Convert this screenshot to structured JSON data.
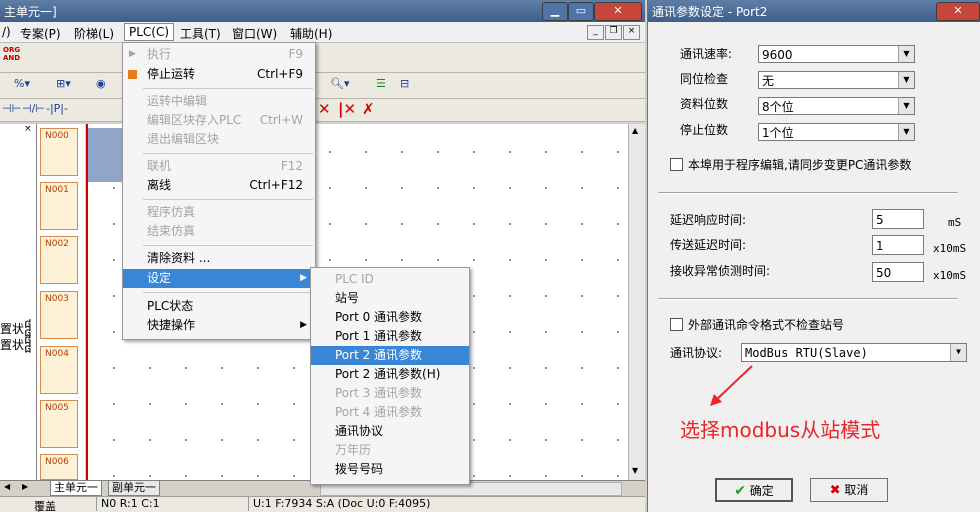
{
  "left_window": {
    "title": "主单元一]",
    "menubar": [
      "/) ",
      "专案(P)",
      "阶梯(L)",
      "PLC(C)",
      "工具(T)",
      "窗口(W)",
      "辅助(H)"
    ],
    "rungs": [
      "N000",
      "N001",
      "N002",
      "N003",
      "N004",
      "N005",
      "N006"
    ],
    "left_pane_text": [
      "置状᧰",
      "置状᧰"
    ],
    "tabs": [
      "主单元一",
      "副单元一"
    ],
    "status": {
      "left": "覆盖",
      "mid": "N0 R:1 C:1",
      "right": "U:1 F:7934 S:A (Doc U:0 F:4095)"
    },
    "toolbar_label": "ORG AND"
  },
  "plc_menu": {
    "items": [
      {
        "label": "执行",
        "shortcut": "F9",
        "disabled": true
      },
      {
        "label": "停止运转",
        "shortcut": "Ctrl+F9",
        "disabled": false
      },
      {
        "sep": true
      },
      {
        "label": "运转中编辑",
        "shortcut": "",
        "disabled": true
      },
      {
        "label": "编辑区块存入PLC",
        "shortcut": "Ctrl+W",
        "disabled": true
      },
      {
        "label": "退出编辑区块",
        "shortcut": "",
        "disabled": true
      },
      {
        "sep": true
      },
      {
        "label": "联机",
        "shortcut": "F12",
        "disabled": true
      },
      {
        "label": "离线",
        "shortcut": "Ctrl+F12",
        "disabled": false
      },
      {
        "sep": true
      },
      {
        "label": "程序仿真",
        "shortcut": "",
        "disabled": true
      },
      {
        "label": "结束仿真",
        "shortcut": "",
        "disabled": true
      },
      {
        "sep": true
      },
      {
        "label": "清除资料 ...",
        "shortcut": "",
        "disabled": false
      },
      {
        "label": "设定",
        "shortcut": "",
        "disabled": false,
        "highlight": true,
        "submenu": true
      },
      {
        "sep": true
      },
      {
        "label": "PLC状态",
        "shortcut": "",
        "disabled": false
      },
      {
        "label": "快捷操作",
        "shortcut": "",
        "disabled": false,
        "submenu": true
      }
    ]
  },
  "settings_submenu": {
    "items": [
      {
        "label": "PLC ID",
        "disabled": true
      },
      {
        "label": "站号",
        "disabled": false
      },
      {
        "label": "Port 0 通讯参数",
        "disabled": false
      },
      {
        "label": "Port 1 通讯参数",
        "disabled": false
      },
      {
        "label": "Port 2 通讯参数",
        "disabled": false,
        "highlight": true
      },
      {
        "label": "Port 2 通讯参数(H)",
        "disabled": false
      },
      {
        "label": "Port 3 通讯参数",
        "disabled": true
      },
      {
        "label": "Port 4 通讯参数",
        "disabled": true
      },
      {
        "label": "通讯协议",
        "disabled": false
      },
      {
        "label": "万年历",
        "disabled": true
      },
      {
        "label": "拨号号码",
        "disabled": false
      }
    ]
  },
  "dialog": {
    "title": "通讯参数设定 - Port2",
    "baud_label": "通讯速率:",
    "baud_value": "9600",
    "parity_label": "同位检查",
    "parity_value": "无",
    "databits_label": "资料位数",
    "databits_value": "8个位",
    "stopbits_label": "停止位数",
    "stopbits_value": "1个位",
    "sync_checkbox": "本埠用于程序编辑,请同步变更PC通讯参数",
    "delay_label": "延迟响应时间:",
    "delay_value": "5",
    "delay_unit": "mS",
    "tx_label": "传送延迟时间:",
    "tx_value": "1",
    "tx_unit": "x10mS",
    "rx_label": "接收异常侦测时间:",
    "rx_value": "50",
    "rx_unit": "x10mS",
    "ext_checkbox": "外部通讯命令格式不检查站号",
    "protocol_label": "通讯协议:",
    "protocol_value": "ModBus RTU(Slave)",
    "annotation": "选择modbus从站模式",
    "ok_label": "确定",
    "cancel_label": "取消"
  },
  "colors": {
    "annotation": "#e8262a",
    "highlight": "#3a86d6",
    "rail": "#d00000"
  }
}
